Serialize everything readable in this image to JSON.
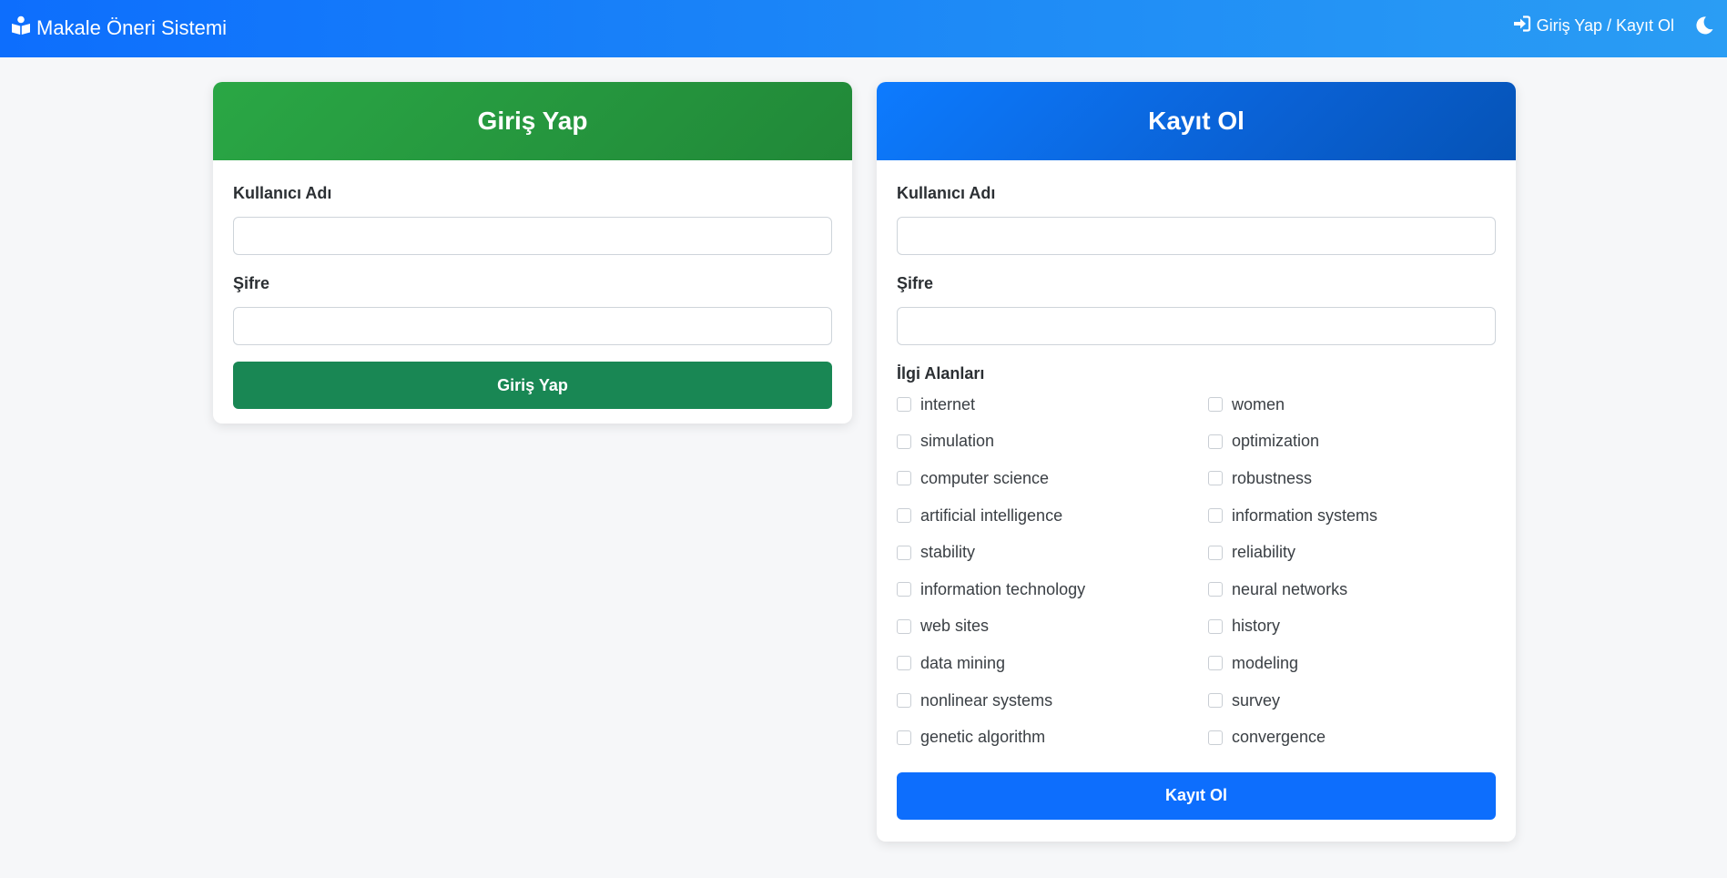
{
  "navbar": {
    "brand_label": "Makale Öneri Sistemi",
    "brand_icon": "book-reader-icon",
    "login_label": "Giriş Yap / Kayıt Ol",
    "login_icon": "sign-in-icon",
    "theme_icon": "moon-icon"
  },
  "login": {
    "title": "Giriş Yap",
    "username_label": "Kullanıcı Adı",
    "username_value": "",
    "password_label": "Şifre",
    "password_value": "",
    "submit_label": "Giriş Yap"
  },
  "register": {
    "title": "Kayıt Ol",
    "username_label": "Kullanıcı Adı",
    "username_value": "",
    "password_label": "Şifre",
    "password_value": "",
    "interests_label": "İlgi Alanları",
    "interests": [
      {
        "label": "internet",
        "checked": false
      },
      {
        "label": "women",
        "checked": false
      },
      {
        "label": "simulation",
        "checked": false
      },
      {
        "label": "optimization",
        "checked": false
      },
      {
        "label": "computer science",
        "checked": false
      },
      {
        "label": "robustness",
        "checked": false
      },
      {
        "label": "artificial intelligence",
        "checked": false
      },
      {
        "label": "information systems",
        "checked": false
      },
      {
        "label": "stability",
        "checked": false
      },
      {
        "label": "reliability",
        "checked": false
      },
      {
        "label": "information technology",
        "checked": false
      },
      {
        "label": "neural networks",
        "checked": false
      },
      {
        "label": "web sites",
        "checked": false
      },
      {
        "label": "history",
        "checked": false
      },
      {
        "label": "data mining",
        "checked": false
      },
      {
        "label": "modeling",
        "checked": false
      },
      {
        "label": "nonlinear systems",
        "checked": false
      },
      {
        "label": "survey",
        "checked": false
      },
      {
        "label": "genetic algorithm",
        "checked": false
      },
      {
        "label": "convergence",
        "checked": false
      }
    ],
    "submit_label": "Kayıt Ol"
  },
  "colors": {
    "navbar_start": "#0d6efd",
    "navbar_end": "#2a9df4",
    "login_header": "#28a745",
    "login_button": "#198754",
    "register_header": "#0a61d4",
    "register_button": "#0d6efd",
    "page_background": "#f6f7f9"
  }
}
